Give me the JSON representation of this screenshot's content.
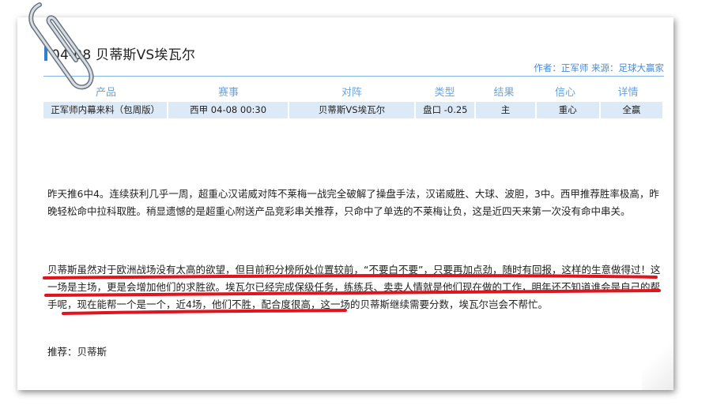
{
  "article": {
    "title": "04-08  贝蒂斯VS埃瓦尔",
    "meta": "作者：正军师  来源：足球大赢家"
  },
  "table": {
    "headers": [
      "产品",
      "赛事",
      "对阵",
      "类型",
      "结果",
      "信心",
      "详情"
    ],
    "row": [
      "正军师内幕来料（包周版）",
      "西甲 04-08 00:30",
      "贝蒂斯VS埃瓦尔",
      "盘口 -0.25",
      "主",
      "重心",
      "全赢"
    ]
  },
  "body": {
    "para1": "昨天推6中4。连续获利几乎一周，超重心汉诺威对阵不莱梅一战完全破解了操盘手法，汉诺威胜、大球、波胆，3中。西甲推荐胜率极高，昨晚轻松命中拉科取胜。稍显遗憾的是超重心附送产品竞彩串关推荐，只命中了单选的不莱梅让负，这是近四天来第一次没有命中串关。",
    "para2": "贝蒂斯虽然对于欧洲战场没有太高的欲望，但目前积分榜所处位置较前，“不要白不要”，只要再加点劲，随时有回报，这样的生意做得过！这一场是主场，更是会增加他们的求胜欲。埃瓦尔已经完成保级任务，练练兵、卖卖人情就是他们现在做的工作，明年还不知道谁会是自己的帮手呢，现在能帮一个是一个，近4场，他们不胜，配合度很高，这一场的贝蒂斯继续需要分数，埃瓦尔岂会不帮忙。",
    "recommend": "推荐：贝蒂斯"
  },
  "colors": {
    "accent": "#2f7fd0",
    "link": "#4b8bd3",
    "cell_bg": "#dce9f6",
    "underline": "#e0141e"
  },
  "icons": [
    "paperclip-icon"
  ]
}
